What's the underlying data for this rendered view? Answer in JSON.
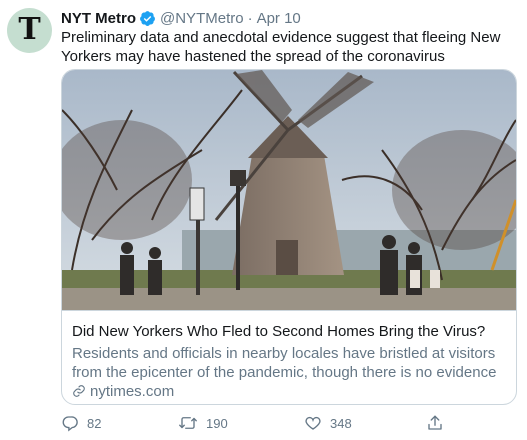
{
  "tweet": {
    "author_name": "NYT Metro",
    "handle": "@NYTMetro",
    "separator": "·",
    "date": "Apr 10",
    "text": "Preliminary data and anecdotal evidence suggest that fleeing New Yorkers may have hastened the spread of the coronavirus",
    "avatar_glyph": "T",
    "avatar_icon": "nyt-logo-icon",
    "verified_icon": "verified-badge-icon"
  },
  "card": {
    "title": "Did New Yorkers Who Fled to Second Homes Bring the Virus?",
    "description": "Residents and officials in nearby locales have bristled at visitors from the epicenter of the pandemic, though there is no evidence that the out-of-...",
    "domain": "nytimes.com",
    "link_icon": "link-icon",
    "image_subject": "windmill-photo"
  },
  "actions": {
    "reply_count": "82",
    "retweet_count": "190",
    "like_count": "348",
    "reply_icon": "reply-icon",
    "retweet_icon": "retweet-icon",
    "like_icon": "heart-icon",
    "share_icon": "share-icon"
  },
  "colors": {
    "text_primary": "#14171a",
    "text_secondary": "#657786",
    "verified_blue": "#1da1f2",
    "avatar_bg": "#c5ded0",
    "border": "#ccd6dd"
  }
}
